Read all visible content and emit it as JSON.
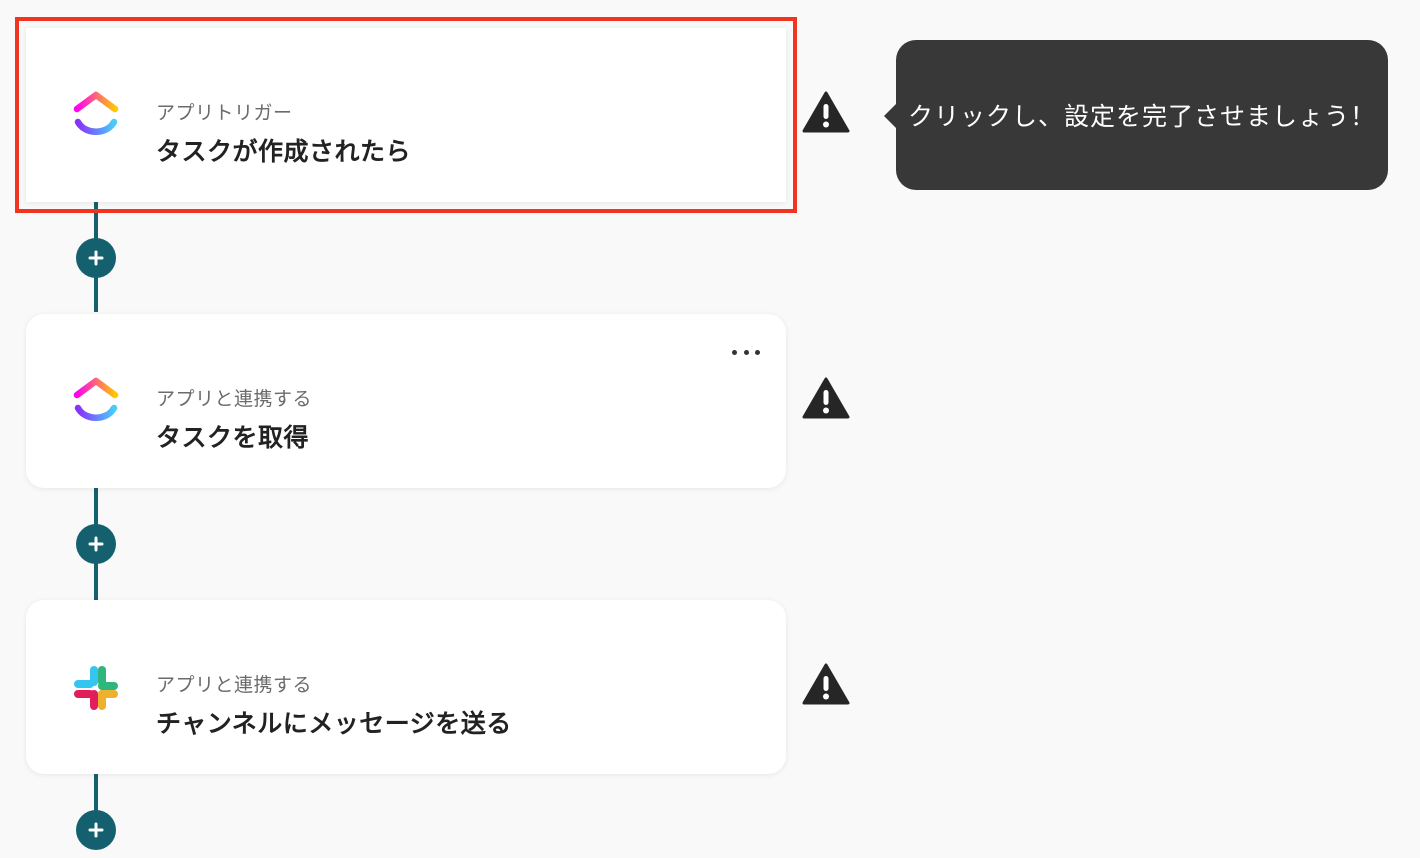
{
  "steps": [
    {
      "kind": "アプリトリガー",
      "title": "タスクが作成されたら",
      "app_icon": "clickup-logo-icon",
      "selected": true
    },
    {
      "kind": "アプリと連携する",
      "title": "タスクを取得",
      "app_icon": "clickup-logo-icon",
      "has_menu": true
    },
    {
      "kind": "アプリと連携する",
      "title": "チャンネルにメッセージを送る",
      "app_icon": "slack-logo-icon"
    }
  ],
  "tooltip": {
    "text": "クリックし、設定を完了させましょう！"
  },
  "icons": {
    "warning": "warning-triangle-icon",
    "add": "plus-icon",
    "menu": "more-dots-icon"
  },
  "colors": {
    "accent": "#15606e",
    "selection_border": "#f0341f",
    "tooltip_bg": "#383838"
  }
}
